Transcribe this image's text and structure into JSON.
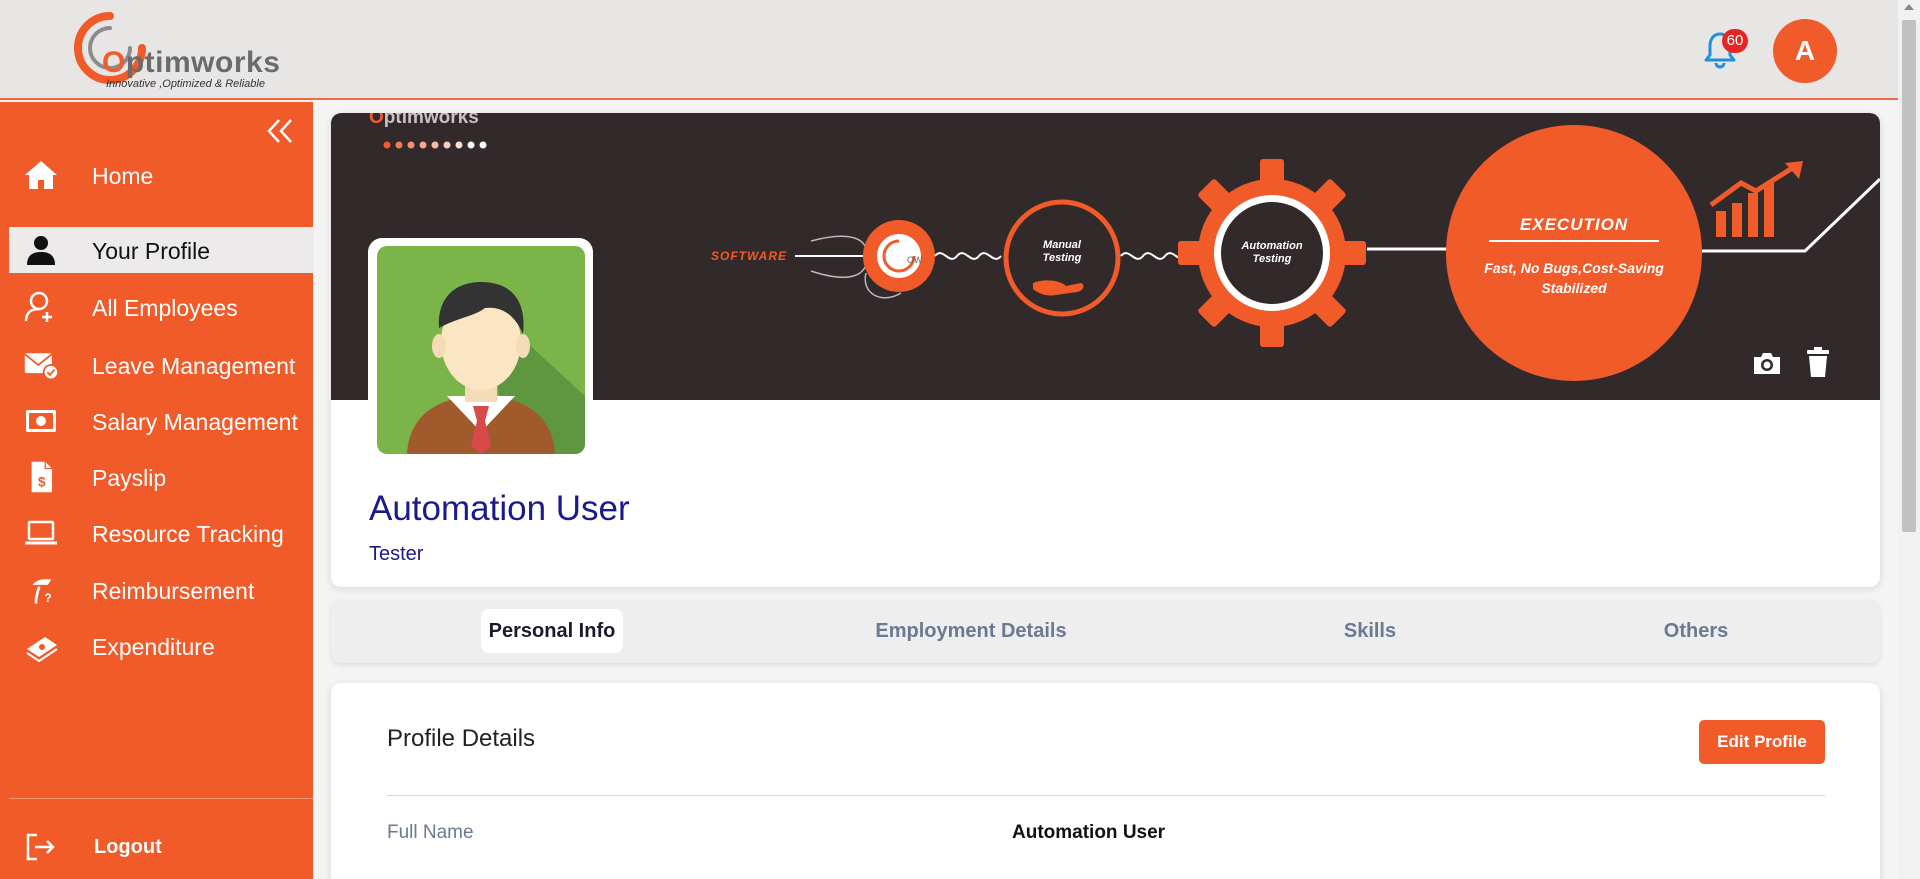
{
  "brand": {
    "name_o": "O",
    "name_rest": "ptimworks",
    "tagline": "Innovative ,Optimized & Reliable",
    "accent_color": "#f15a29"
  },
  "header": {
    "notification_count": "60",
    "avatar_letter": "A",
    "notification_icon": "bell-icon"
  },
  "sidebar": {
    "items": [
      {
        "label": "Home",
        "icon": "home-icon"
      },
      {
        "label": "Your Profile",
        "icon": "user-icon"
      },
      {
        "label": "All Employees",
        "icon": "users-icon"
      },
      {
        "label": "Leave Management",
        "icon": "mail-check-icon"
      },
      {
        "label": "Salary Management",
        "icon": "money-icon"
      },
      {
        "label": "Payslip",
        "icon": "payslip-icon"
      },
      {
        "label": "Resource Tracking",
        "icon": "laptop-icon"
      },
      {
        "label": "Reimbursement",
        "icon": "reimbursement-icon"
      },
      {
        "label": "Expenditure",
        "icon": "cash-stack-icon"
      }
    ],
    "active_index": 1,
    "logout_label": "Logout"
  },
  "banner": {
    "logo_o": "O",
    "logo_rest": "ptimworks",
    "step_software": "SOFTWARE",
    "step_ow": "OW",
    "step_manual_1": "Manual",
    "step_manual_2": "Testing",
    "step_auto_1": "Automation",
    "step_auto_2": "Testing",
    "execution_title": "EXECUTION",
    "execution_line1": "Fast, No Bugs,Cost-Saving",
    "execution_line2": "Stabilized"
  },
  "profile": {
    "name": "Automation User",
    "role": "Tester"
  },
  "tabs": [
    {
      "label": "Personal Info",
      "active": true
    },
    {
      "label": "Employment Details",
      "active": false
    },
    {
      "label": "Skills",
      "active": false
    },
    {
      "label": "Others",
      "active": false
    }
  ],
  "details": {
    "section_title": "Profile Details",
    "edit_label": "Edit Profile",
    "fields": [
      {
        "label": "Full Name",
        "value": "Automation User"
      }
    ]
  }
}
